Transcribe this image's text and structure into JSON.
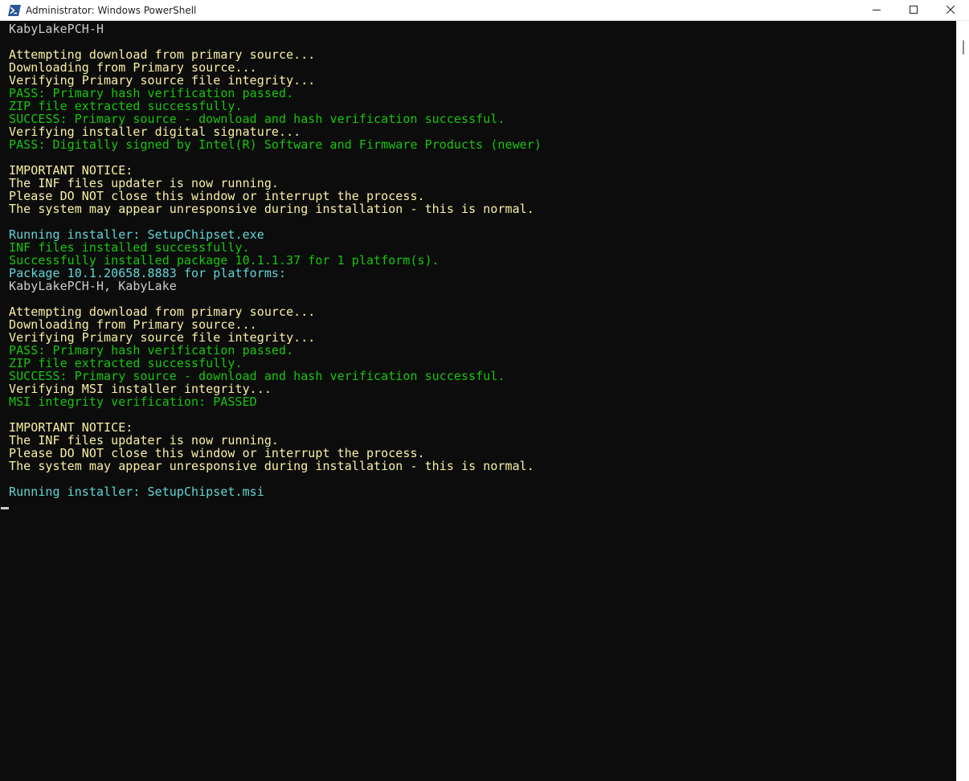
{
  "window": {
    "title": "Administrator: Windows PowerShell",
    "app_icon": "powershell-icon",
    "controls": {
      "minimize_icon": "minimize-icon",
      "maximize_icon": "maximize-icon",
      "close_icon": "close-icon"
    }
  },
  "colors": {
    "background": "#0c0c0c",
    "white": "#cccccc",
    "yellow": "#f9f1a5",
    "green": "#16c60c",
    "cyan": "#61d6d6"
  },
  "console": {
    "lines": [
      {
        "text": "KabyLakePCH-H",
        "color": "white"
      },
      {
        "text": "",
        "color": "white"
      },
      {
        "text": "Attempting download from primary source...",
        "color": "yellow"
      },
      {
        "text": "Downloading from Primary source...",
        "color": "yellow"
      },
      {
        "text": "Verifying Primary source file integrity...",
        "color": "yellow"
      },
      {
        "text": "PASS: Primary hash verification passed.",
        "color": "green"
      },
      {
        "text": "ZIP file extracted successfully.",
        "color": "green"
      },
      {
        "text": "SUCCESS: Primary source - download and hash verification successful.",
        "color": "green"
      },
      {
        "text": "Verifying installer digital signature...",
        "color": "yellow"
      },
      {
        "text": "PASS: Digitally signed by Intel(R) Software and Firmware Products (newer)",
        "color": "green"
      },
      {
        "text": "",
        "color": "white"
      },
      {
        "text": "IMPORTANT NOTICE:",
        "color": "yellow"
      },
      {
        "text": "The INF files updater is now running.",
        "color": "yellow"
      },
      {
        "text": "Please DO NOT close this window or interrupt the process.",
        "color": "yellow"
      },
      {
        "text": "The system may appear unresponsive during installation - this is normal.",
        "color": "yellow"
      },
      {
        "text": "",
        "color": "white"
      },
      {
        "text": "Running installer: SetupChipset.exe",
        "color": "cyan"
      },
      {
        "text": "INF files installed successfully.",
        "color": "green"
      },
      {
        "text": "Successfully installed package 10.1.1.37 for 1 platform(s).",
        "color": "green"
      },
      {
        "text": "Package 10.1.20658.8883 for platforms:",
        "color": "cyan"
      },
      {
        "text": "KabyLakePCH-H, KabyLake",
        "color": "white"
      },
      {
        "text": "",
        "color": "white"
      },
      {
        "text": "Attempting download from primary source...",
        "color": "yellow"
      },
      {
        "text": "Downloading from Primary source...",
        "color": "yellow"
      },
      {
        "text": "Verifying Primary source file integrity...",
        "color": "yellow"
      },
      {
        "text": "PASS: Primary hash verification passed.",
        "color": "green"
      },
      {
        "text": "ZIP file extracted successfully.",
        "color": "green"
      },
      {
        "text": "SUCCESS: Primary source - download and hash verification successful.",
        "color": "green"
      },
      {
        "text": "Verifying MSI installer integrity...",
        "color": "yellow"
      },
      {
        "text": "MSI integrity verification: PASSED",
        "color": "green"
      },
      {
        "text": "",
        "color": "white"
      },
      {
        "text": "IMPORTANT NOTICE:",
        "color": "yellow"
      },
      {
        "text": "The INF files updater is now running.",
        "color": "yellow"
      },
      {
        "text": "Please DO NOT close this window or interrupt the process.",
        "color": "yellow"
      },
      {
        "text": "The system may appear unresponsive during installation - this is normal.",
        "color": "yellow"
      },
      {
        "text": "",
        "color": "white"
      },
      {
        "text": "Running installer: SetupChipset.msi",
        "color": "cyan"
      }
    ]
  }
}
